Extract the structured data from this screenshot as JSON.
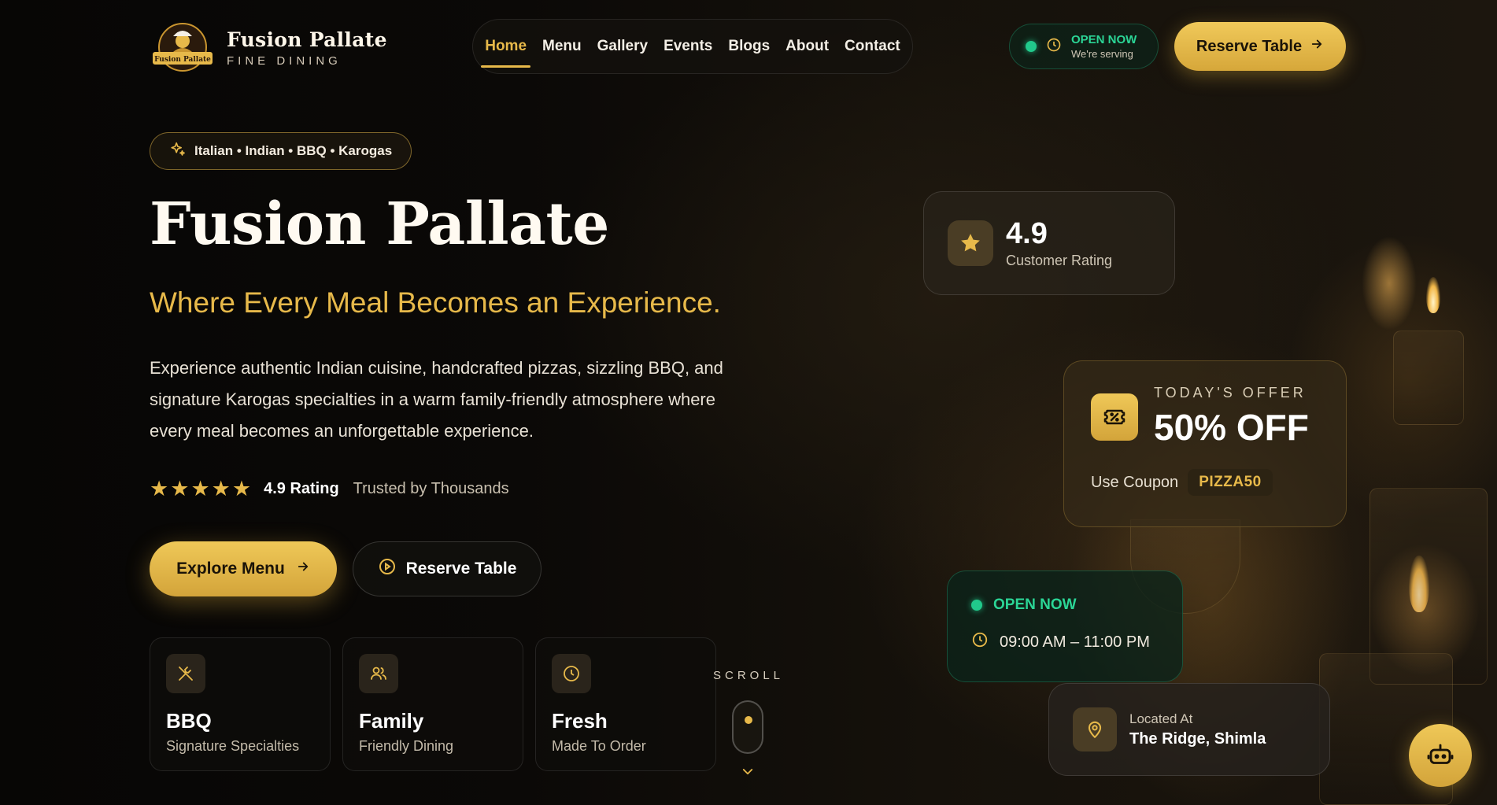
{
  "brand": {
    "name": "Fusion Pallate",
    "tagline": "FINE DINING",
    "badge_text": "Fusion Pallate"
  },
  "nav": {
    "items": [
      {
        "label": "Home",
        "active": true
      },
      {
        "label": "Menu"
      },
      {
        "label": "Gallery"
      },
      {
        "label": "Events"
      },
      {
        "label": "Blogs"
      },
      {
        "label": "About"
      },
      {
        "label": "Contact"
      }
    ]
  },
  "status_pill": {
    "title": "OPEN NOW",
    "subtitle": "We're serving"
  },
  "header_cta": {
    "label": "Reserve Table"
  },
  "hero": {
    "tag": "Italian • Indian • BBQ • Karogas",
    "title": "Fusion Pallate",
    "subtitle": "Where Every Meal Becomes an Experience.",
    "description": "Experience authentic Indian cuisine, handcrafted pizzas, sizzling BBQ, and signature Karogas specialties in a warm family-friendly atmosphere where every meal becomes an unforgettable experience.",
    "rating": {
      "stars": 5,
      "value": "4.9 Rating",
      "trust": "Trusted by Thousands"
    },
    "buttons": {
      "explore": "Explore Menu",
      "reserve": "Reserve Table"
    }
  },
  "features": [
    {
      "title": "BBQ",
      "subtitle": "Signature Specialties",
      "icon": "utensils-icon"
    },
    {
      "title": "Family",
      "subtitle": "Friendly Dining",
      "icon": "users-icon"
    },
    {
      "title": "Fresh",
      "subtitle": "Made To Order",
      "icon": "clock-icon"
    }
  ],
  "scroll": {
    "label": "SCROLL"
  },
  "cards": {
    "rating": {
      "value": "4.9",
      "label": "Customer Rating"
    },
    "offer": {
      "label": "TODAY'S OFFER",
      "value": "50% OFF",
      "coupon_label": "Use Coupon",
      "coupon_code": "PIZZA50"
    },
    "hours": {
      "status": "OPEN NOW",
      "time": "09:00 AM – 11:00 PM"
    },
    "location": {
      "label": "Located At",
      "value": "The Ridge, Shimla"
    }
  },
  "colors": {
    "gold": "#e7b94a",
    "green": "#21c98b",
    "background": "#0b0907"
  }
}
